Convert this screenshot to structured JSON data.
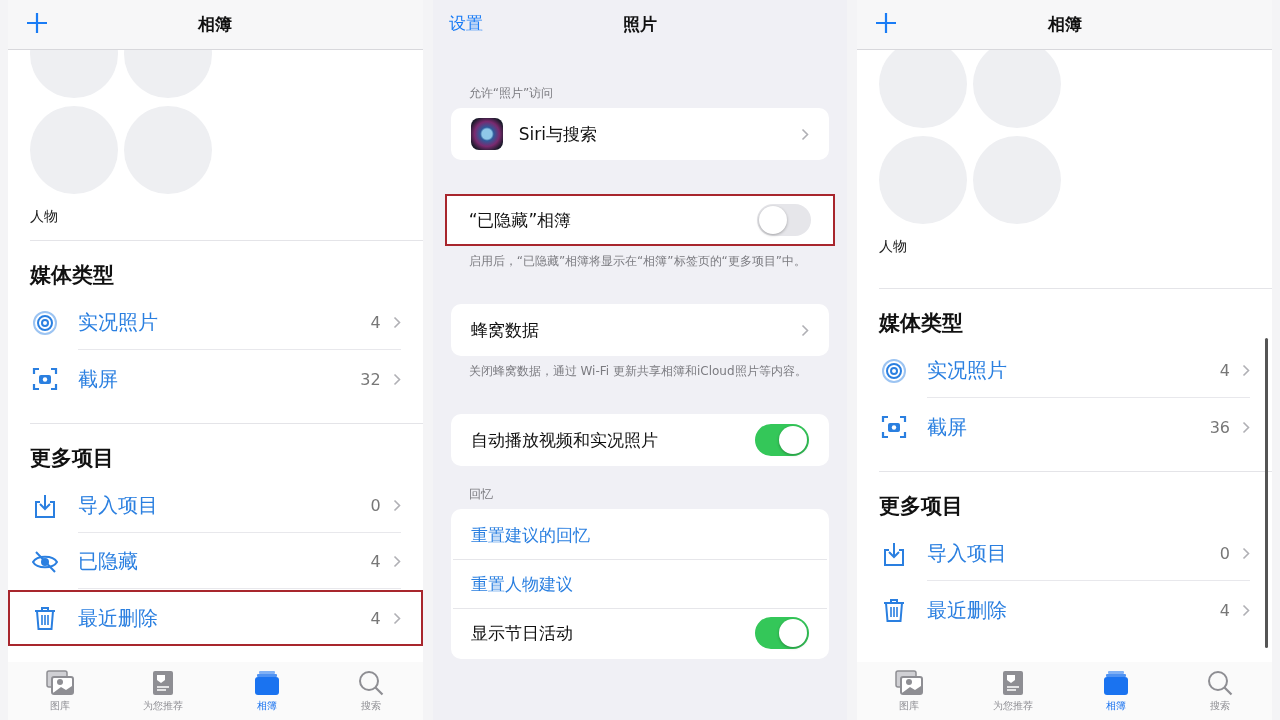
{
  "panels": [
    {
      "kind": "albums",
      "title": "相簿",
      "people_label": "人物",
      "sections": [
        {
          "title": "媒体类型",
          "items": [
            {
              "kind": "live",
              "label": "实况照片",
              "count": "4",
              "highlighted": false
            },
            {
              "kind": "screenshot",
              "label": "截屏",
              "count": "32",
              "highlighted": false
            }
          ]
        },
        {
          "title": "更多项目",
          "items": [
            {
              "kind": "import",
              "label": "导入项目",
              "count": "0",
              "highlighted": false
            },
            {
              "kind": "hidden",
              "label": "已隐藏",
              "count": "4",
              "highlighted": false
            },
            {
              "kind": "trash",
              "label": "最近删除",
              "count": "4",
              "highlighted": true
            }
          ]
        }
      ],
      "tabs": [
        {
          "kind": "photos",
          "label": "图库",
          "selected": false
        },
        {
          "kind": "foryou",
          "label": "为您推荐",
          "selected": false
        },
        {
          "kind": "albums",
          "label": "相簿",
          "selected": true
        },
        {
          "kind": "search",
          "label": "搜索",
          "selected": false
        }
      ]
    },
    {
      "kind": "settings",
      "back": "设置",
      "title": "照片",
      "groups": [
        {
          "header": "允许“照片”访问",
          "highlighted": false,
          "rows": [
            {
              "kind": "app-link",
              "label": "Siri与搜索"
            }
          ]
        },
        {
          "highlighted": true,
          "rows": [
            {
              "kind": "toggle",
              "label": "“已隐藏”相簿",
              "on": false
            }
          ],
          "footer": "启用后，“已隐藏”相簿将显示在“相簿”标签页的“更多项目”中。"
        },
        {
          "highlighted": false,
          "rows": [
            {
              "kind": "link",
              "label": "蜂窝数据"
            }
          ],
          "footer": "关闭蜂窝数据，通过 Wi-Fi 更新共享相簿和iCloud照片等内容。"
        },
        {
          "highlighted": false,
          "rows": [
            {
              "kind": "toggle",
              "label": "自动播放视频和实况照片",
              "on": true
            }
          ]
        },
        {
          "header": "回忆",
          "highlighted": false,
          "rows": [
            {
              "kind": "action",
              "label": "重置建议的回忆"
            },
            {
              "kind": "action",
              "label": "重置人物建议"
            },
            {
              "kind": "toggle",
              "label": "显示节日活动",
              "on": true
            }
          ]
        }
      ]
    },
    {
      "kind": "albums",
      "title": "相簿",
      "people_label": "人物",
      "sections": [
        {
          "title": "媒体类型",
          "items": [
            {
              "kind": "live",
              "label": "实况照片",
              "count": "4",
              "highlighted": false
            },
            {
              "kind": "screenshot",
              "label": "截屏",
              "count": "36",
              "highlighted": false
            }
          ]
        },
        {
          "title": "更多项目",
          "items": [
            {
              "kind": "import",
              "label": "导入项目",
              "count": "0",
              "highlighted": false
            },
            {
              "kind": "trash",
              "label": "最近删除",
              "count": "4",
              "highlighted": false
            }
          ]
        }
      ],
      "tabs": [
        {
          "kind": "photos",
          "label": "图库",
          "selected": false
        },
        {
          "kind": "foryou",
          "label": "为您推荐",
          "selected": false
        },
        {
          "kind": "albums",
          "label": "相簿",
          "selected": true
        },
        {
          "kind": "search",
          "label": "搜索",
          "selected": false
        }
      ]
    }
  ]
}
